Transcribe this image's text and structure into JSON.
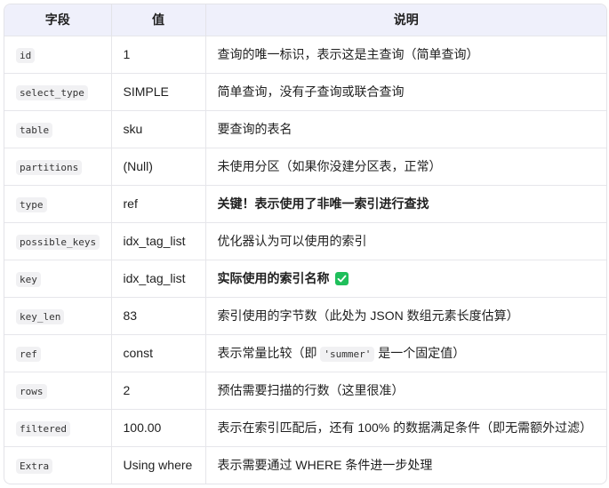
{
  "header": {
    "col_field": "字段",
    "col_value": "值",
    "col_desc": "说明"
  },
  "rows": [
    {
      "field": "id",
      "value": "1",
      "desc": "查询的唯一标识，表示这是主查询（简单查询）"
    },
    {
      "field": "select_type",
      "value": "SIMPLE",
      "desc": "简单查询，没有子查询或联合查询"
    },
    {
      "field": "table",
      "value": "sku",
      "desc": "要查询的表名"
    },
    {
      "field": "partitions",
      "value": "(Null)",
      "desc": "未使用分区（如果你没建分区表，正常）"
    },
    {
      "field": "type",
      "value": "ref",
      "desc": "关键！表示使用了非唯一索引进行查找"
    },
    {
      "field": "possible_keys",
      "value": "idx_tag_list",
      "desc": "优化器认为可以使用的索引"
    },
    {
      "field": "key",
      "value": "idx_tag_list",
      "desc": "实际使用的索引名称"
    },
    {
      "field": "key_len",
      "value": "83",
      "desc": "索引使用的字节数（此处为 JSON 数组元素长度估算）"
    },
    {
      "field": "ref",
      "value": "const",
      "desc_before": "表示常量比较（即 ",
      "desc_code": "'summer'",
      "desc_after": " 是一个固定值）"
    },
    {
      "field": "rows",
      "value": "2",
      "desc": "预估需要扫描的行数（这里很准）"
    },
    {
      "field": "filtered",
      "value": "100.00",
      "desc": "表示在索引匹配后，还有 100% 的数据满足条件（即无需额外过滤）"
    },
    {
      "field": "Extra",
      "value": "Using where",
      "desc": "表示需要通过 WHERE 条件进一步处理"
    }
  ],
  "icons": {
    "check": "check-mark-icon",
    "check_color": "#1fbf5b"
  }
}
